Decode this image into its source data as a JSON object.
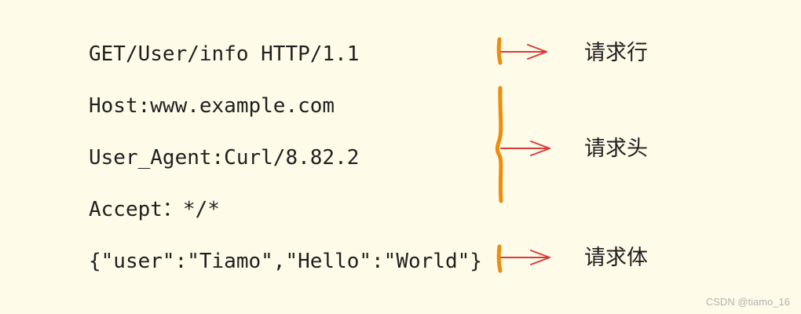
{
  "request": {
    "lines": [
      "GET/User/info HTTP/1.1",
      "Host:www.example.com",
      "User_Agent:Curl/8.82.2",
      "Accept：*/*",
      "{\"user\":\"Tiamo\",\"Hello\":\"World\"}"
    ]
  },
  "labels": {
    "request_line": "请求行",
    "request_header": "请求头",
    "request_body": "请求体"
  },
  "watermark": "CSDN @tiamo_16",
  "colors": {
    "background": "#fefbe8",
    "bracket": "#ee8c0c",
    "arrow": "#d93a3a",
    "text": "#1f1f1f"
  }
}
